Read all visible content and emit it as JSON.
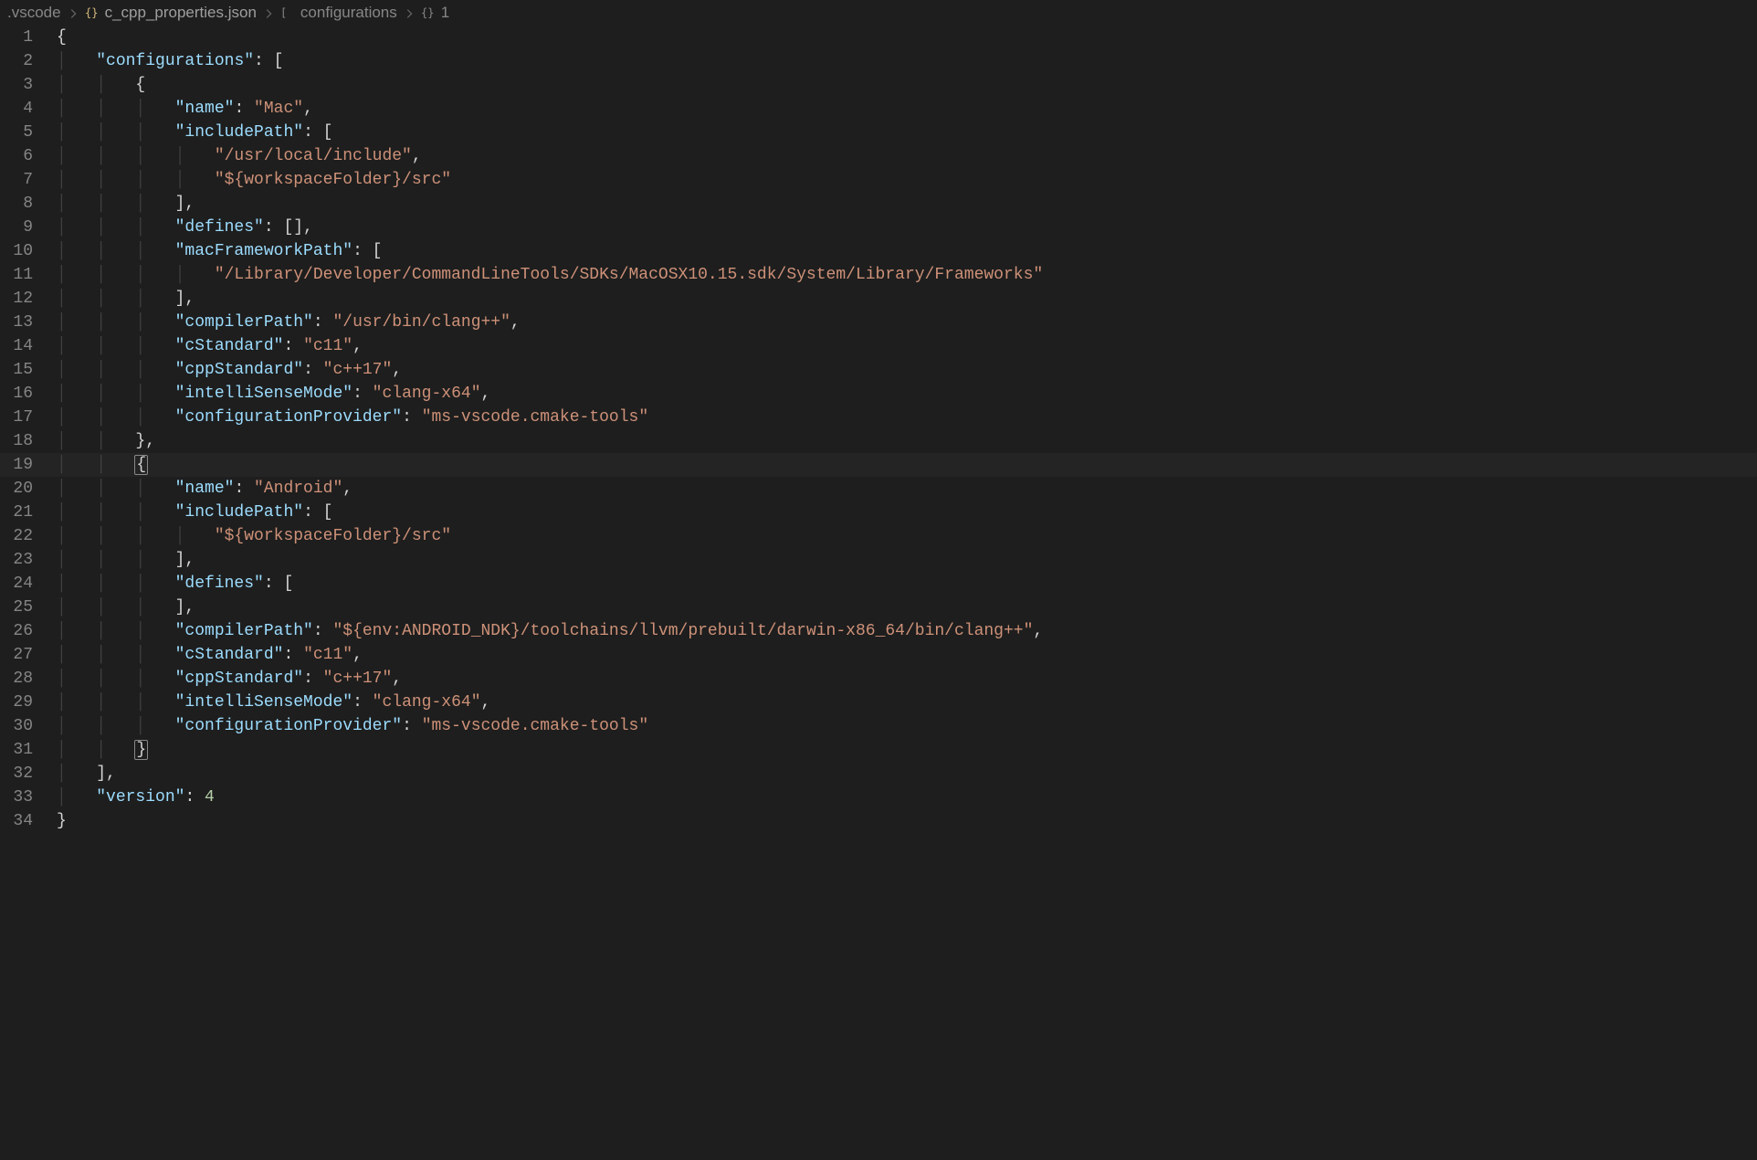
{
  "breadcrumb": {
    "folder": ".vscode",
    "file": "c_cpp_properties.json",
    "path1": "configurations",
    "path2": "1"
  },
  "lines": {
    "n1": "1",
    "n2": "2",
    "n3": "3",
    "n4": "4",
    "n5": "5",
    "n6": "6",
    "n7": "7",
    "n8": "8",
    "n9": "9",
    "n10": "10",
    "n11": "11",
    "n12": "12",
    "n13": "13",
    "n14": "14",
    "n15": "15",
    "n16": "16",
    "n17": "17",
    "n18": "18",
    "n19": "19",
    "n20": "20",
    "n21": "21",
    "n22": "22",
    "n23": "23",
    "n24": "24",
    "n25": "25",
    "n26": "26",
    "n27": "27",
    "n28": "28",
    "n29": "29",
    "n30": "30",
    "n31": "31",
    "n32": "32",
    "n33": "33",
    "n34": "34"
  },
  "k": {
    "configurations": "\"configurations\"",
    "name": "\"name\"",
    "includePath": "\"includePath\"",
    "defines": "\"defines\"",
    "macFrameworkPath": "\"macFrameworkPath\"",
    "compilerPath": "\"compilerPath\"",
    "cStandard": "\"cStandard\"",
    "cppStandard": "\"cppStandard\"",
    "intelliSenseMode": "\"intelliSenseMode\"",
    "configurationProvider": "\"configurationProvider\"",
    "version": "\"version\""
  },
  "v": {
    "mac": "\"Mac\"",
    "usrLocalInclude": "\"/usr/local/include\"",
    "wsSrc": "\"${workspaceFolder}/src\"",
    "macFwPath": "\"/Library/Developer/CommandLineTools/SDKs/MacOSX10.15.sdk/System/Library/Frameworks\"",
    "clangpp": "\"/usr/bin/clang++\"",
    "c11": "\"c11\"",
    "cpp17": "\"c++17\"",
    "clangx64": "\"clang-x64\"",
    "cmakeTools": "\"ms-vscode.cmake-tools\"",
    "android": "\"Android\"",
    "ndkClang": "\"${env:ANDROID_NDK}/toolchains/llvm/prebuilt/darwin-x86_64/bin/clang++\"",
    "four": "4"
  },
  "punc": {
    "openBrace": "{",
    "closeBrace": "}",
    "openBracket": "[",
    "closeBracket": "]",
    "closeBracketComma": "],",
    "closeBraceComma": "},",
    "colonSpace": ": ",
    "colonSpaceOpenBracket": ": [",
    "colonSpaceOpenBracketCloseBracketComma": ": [],",
    "comma": ","
  }
}
